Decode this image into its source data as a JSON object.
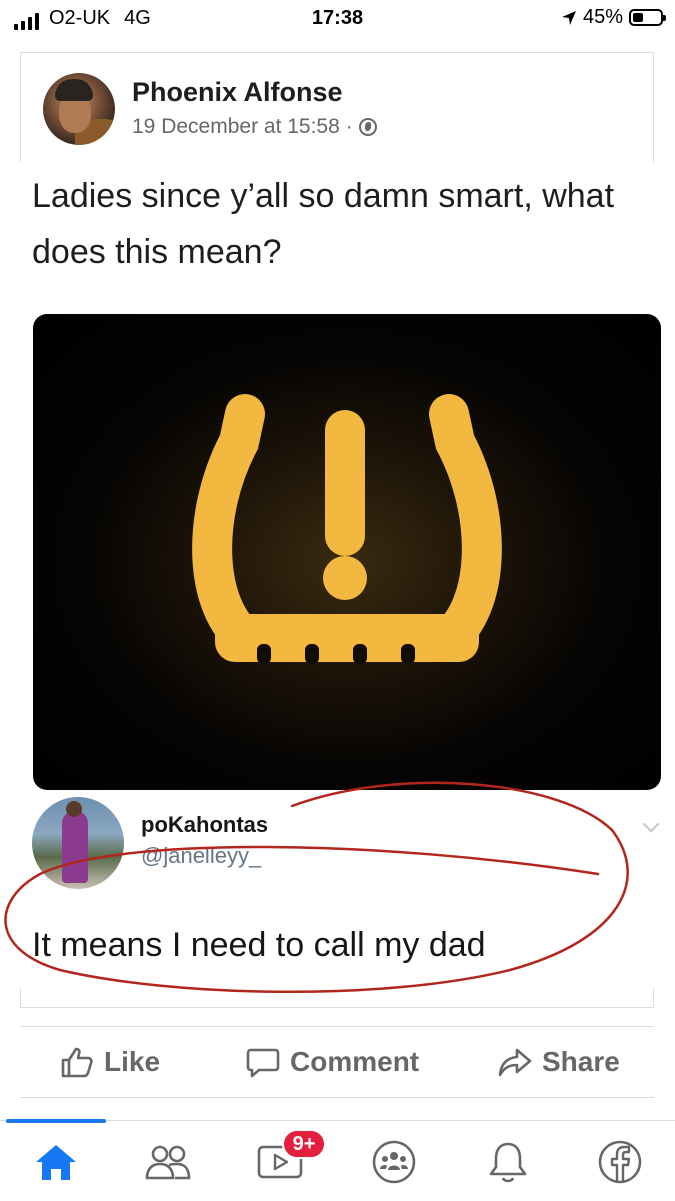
{
  "status_bar": {
    "carrier": "O2-UK",
    "network": "4G",
    "time": "17:38",
    "battery": "45%",
    "battery_level": 0.45
  },
  "post": {
    "author": "Phoenix Alfonse",
    "timestamp": "19 December at 15:58",
    "separator": "·",
    "audience_icon": "globe-icon",
    "text": "Ladies since y’all so damn smart, what does this mean?"
  },
  "embedded_tweet": {
    "name": "poKahontas",
    "handle": "@janelleyy_",
    "text": "It means I need to call my dad"
  },
  "actions": {
    "like": "Like",
    "comment": "Comment",
    "share": "Share"
  },
  "tab_bar": {
    "active_tab": "home",
    "video_badge": "9+",
    "icons": [
      "home-icon",
      "friends-icon",
      "watch-icon",
      "groups-icon",
      "notifications-icon",
      "facebook-menu-icon"
    ]
  },
  "colors": {
    "accent": "#1877f2",
    "warning_amber": "#f3b83f",
    "annotation_red": "#b3261e",
    "badge_red": "#e41e3f",
    "secondary_text": "#65676b"
  }
}
